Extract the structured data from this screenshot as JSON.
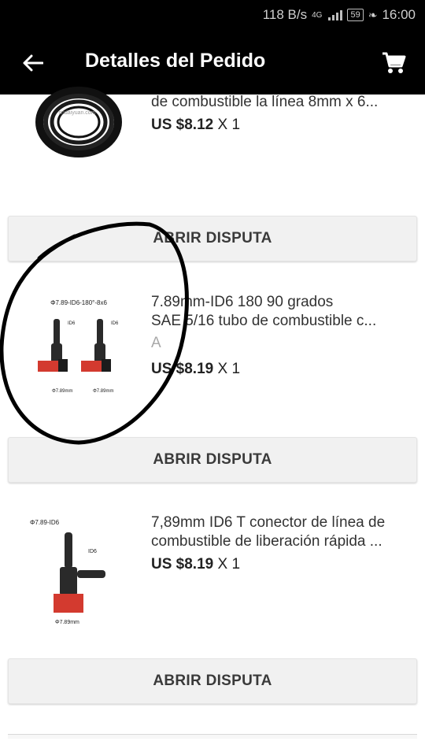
{
  "status_bar": {
    "speed": "118 B/s",
    "network": "4G",
    "battery": "59",
    "time": "16:00"
  },
  "app_bar": {
    "title": "Detalles del Pedido",
    "back_icon": "arrow-left-icon",
    "cart_icon": "cart-icon"
  },
  "items": [
    {
      "name": "de combustible la línea 8mm x 6...",
      "price": "US $8.12",
      "qty": "X 1",
      "image_text": "cndaiyuan.com"
    },
    {
      "name_line1": "7.89mm-ID6 180 90 grados",
      "name_line2": "SAE 5/16 tubo de combustible c...",
      "variant": "A",
      "price": "US $8.19",
      "qty": "X 1",
      "image_text": {
        "caption": "Φ7.89-ID6-180°-8x6",
        "id_label": "ID6",
        "dim_label": "Φ7.89mm"
      }
    },
    {
      "name_line1": "7,89mm ID6 T conector de línea de",
      "name_line2": "combustible de liberación rápida ...",
      "price": "US $8.19",
      "qty": "X 1",
      "image_text": {
        "caption": "Φ7.89-ID6",
        "id_label": "ID6",
        "dim_label": "Φ7.89mm"
      }
    }
  ],
  "dispute_label": "ABRIR DISPUTA",
  "colors": {
    "bar": "#000000",
    "button_bg": "#f1f1f1",
    "connector_red": "#d33a2f"
  }
}
